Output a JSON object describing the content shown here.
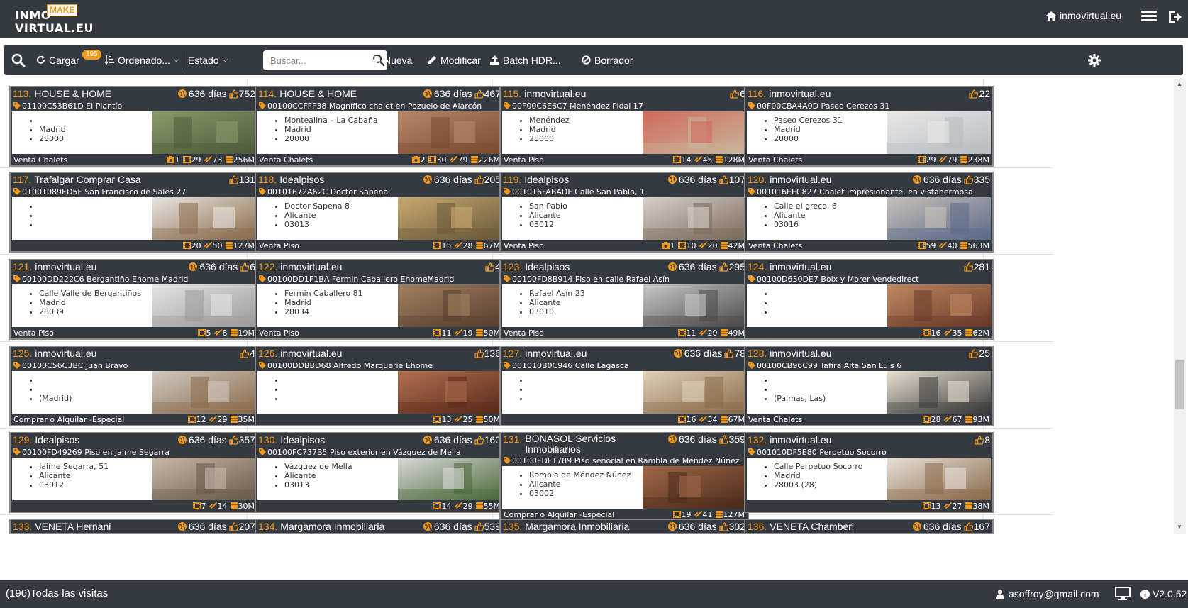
{
  "brand": {
    "line1": "INMO",
    "line2": "VIRTUAL.EU",
    "make": "MAKE"
  },
  "header": {
    "site_link": "inmovirtual.eu"
  },
  "toolbar": {
    "cargar_label": "Cargar",
    "cargar_badge": "195",
    "ordenado_label": "Ordenado...",
    "estado_label": "Estado",
    "search_placeholder": "Buscar...",
    "nueva_label": "Nueva",
    "modificar_label": "Modificar",
    "batch_label": "Batch HDR...",
    "borrador_label": "Borrador"
  },
  "listings": [
    {
      "num": "113.",
      "title": "HOUSE & HOME",
      "days": "636 días",
      "likes": "752",
      "ref": "01100C53B61D El Plantío",
      "lines": [
        "",
        "Madrid",
        "28000"
      ],
      "category": "Venta Chalets",
      "stats": {
        "photos": "1",
        "tours": "29",
        "links": "73",
        "size": "256M"
      }
    },
    {
      "num": "114.",
      "title": "HOUSE & HOME",
      "days": "636 días",
      "likes": "467",
      "ref": "00100CCFFF38 Magnífico chalet en Pozuelo de Alarcón",
      "lines": [
        "Montealina – La Cabaña",
        "Madrid",
        "28000"
      ],
      "category": "Venta Chalets",
      "stats": {
        "photos": "2",
        "tours": "30",
        "links": "79",
        "size": "226M"
      }
    },
    {
      "num": "115.",
      "title": "inmovirtual.eu",
      "days": "",
      "likes": "6",
      "ref": "00F00C6E6C7 Menéndez Pidal 17",
      "lines": [
        "Menéndez",
        "Madrid",
        "28000"
      ],
      "category": "Venta Piso",
      "stats": {
        "photos": "",
        "tours": "14",
        "links": "45",
        "size": "128M"
      }
    },
    {
      "num": "116.",
      "title": "inmovirtual.eu",
      "days": "",
      "likes": "22",
      "ref": "00F00CBA4A0D Paseo Cerezos 31",
      "lines": [
        "Paseo Cerezos 31",
        "Madrid",
        "28000"
      ],
      "category": "Venta Chalets",
      "stats": {
        "photos": "",
        "tours": "29",
        "links": "79",
        "size": "238M"
      }
    },
    {
      "num": "117.",
      "title": "Trafalgar Comprar Casa",
      "days": "",
      "likes": "131",
      "ref": "01001089ED5F San Francisco de Sales 27",
      "lines": [
        "",
        "",
        ""
      ],
      "category": "",
      "stats": {
        "photos": "",
        "tours": "20",
        "links": "50",
        "size": "127M"
      }
    },
    {
      "num": "118.",
      "title": "Idealpisos",
      "days": "636 días",
      "likes": "205",
      "ref": "00101672A62C Doctor Sapena",
      "lines": [
        "Doctor Sapena 8",
        "Alicante",
        "03013"
      ],
      "category": "Venta Piso",
      "stats": {
        "photos": "",
        "tours": "15",
        "links": "28",
        "size": "67M"
      }
    },
    {
      "num": "119.",
      "title": "Idealpisos",
      "days": "636 días",
      "likes": "107",
      "ref": "001016FABADF Calle San Pablo, 1",
      "lines": [
        "San Pablo",
        "Alicante",
        "03012"
      ],
      "category": "Venta Piso",
      "stats": {
        "photos": "1",
        "tours": "10",
        "links": "20",
        "size": "42M"
      }
    },
    {
      "num": "120.",
      "title": "inmovirtual.eu",
      "days": "636 días",
      "likes": "335",
      "ref": "001016EEC827 Chalet impresionante. en vistahermosa",
      "lines": [
        "Calle el greco, 6",
        "Alicante",
        "03016"
      ],
      "category": "Venta Chalets",
      "stats": {
        "photos": "",
        "tours": "59",
        "links": "40",
        "size": "563M"
      }
    },
    {
      "num": "121.",
      "title": "inmovirtual.eu",
      "days": "636 días",
      "likes": "6",
      "ref": "00100DD222C6 Bergantiño Ehome Madrid",
      "lines": [
        "Calle Valle de Bergantiños",
        "Madrid",
        "28039"
      ],
      "category": "Venta Piso",
      "stats": {
        "photos": "",
        "tours": "5",
        "links": "8",
        "size": "19M"
      }
    },
    {
      "num": "122.",
      "title": "inmovirtual.eu",
      "days": "",
      "likes": "4",
      "ref": "00100DD1F1BA Fermin Caballero EhomeMadrid",
      "lines": [
        "Fermin Caballero 81",
        "Madrid",
        "28034"
      ],
      "category": "Venta Piso",
      "stats": {
        "photos": "",
        "tours": "11",
        "links": "19",
        "size": "50M"
      }
    },
    {
      "num": "123.",
      "title": "Idealpisos",
      "days": "636 días",
      "likes": "295",
      "ref": "00100FD8B914 Piso en calle Rafael Asín",
      "lines": [
        "Rafael Asín 23",
        "Alicante",
        "03010"
      ],
      "category": "Venta Piso",
      "stats": {
        "photos": "",
        "tours": "11",
        "links": "20",
        "size": "49M"
      }
    },
    {
      "num": "124.",
      "title": "inmovirtual.eu",
      "days": "",
      "likes": "281",
      "ref": "00100D630DE7 Boix y Morer Vendedirect",
      "lines": [
        "",
        "",
        ""
      ],
      "category": "",
      "stats": {
        "photos": "",
        "tours": "16",
        "links": "35",
        "size": "62M"
      }
    },
    {
      "num": "125.",
      "title": "inmovirtual.eu",
      "days": "",
      "likes": "4",
      "ref": "00100C56C3BC Juan Bravo",
      "lines": [
        "",
        "",
        "(Madrid)"
      ],
      "category": "Comprar o Alquilar -Especial",
      "stats": {
        "photos": "",
        "tours": "12",
        "links": "29",
        "size": "35M"
      }
    },
    {
      "num": "126.",
      "title": "inmovirtual.eu",
      "days": "",
      "likes": "136",
      "ref": "00100DDBBD68 Alfredo Marquerie Ehome",
      "lines": [
        "",
        "",
        ""
      ],
      "category": "",
      "stats": {
        "photos": "",
        "tours": "13",
        "links": "25",
        "size": "50M"
      }
    },
    {
      "num": "127.",
      "title": "inmovirtual.eu",
      "days": "636 días",
      "likes": "78",
      "ref": "001010B0C946 Calle Lagasca",
      "lines": [
        "",
        "",
        ""
      ],
      "category": "",
      "stats": {
        "photos": "",
        "tours": "16",
        "links": "34",
        "size": "67M"
      }
    },
    {
      "num": "128.",
      "title": "inmovirtual.eu",
      "days": "",
      "likes": "25",
      "ref": "00100CB96C99 Tafira Alta San Luis 6",
      "lines": [
        "",
        "",
        "(Palmas, Las)"
      ],
      "category": "Venta Chalets",
      "stats": {
        "photos": "",
        "tours": "28",
        "links": "67",
        "size": "93M"
      }
    },
    {
      "num": "129.",
      "title": "Idealpisos",
      "days": "636 días",
      "likes": "357",
      "ref": "00100FD49269 Piso en Jaime Segarra",
      "lines": [
        "Jaime Segarra, 51",
        "Alicante",
        "03012"
      ],
      "category": "",
      "stats": {
        "photos": "",
        "tours": "7",
        "links": "14",
        "size": "30M"
      }
    },
    {
      "num": "130.",
      "title": "Idealpisos",
      "days": "636 días",
      "likes": "160",
      "ref": "00100FC737B5 Piso exterior en Vázquez de Mella",
      "lines": [
        "Vázquez de Mella",
        "Alicante",
        "03013"
      ],
      "category": "",
      "stats": {
        "photos": "",
        "tours": "14",
        "links": "29",
        "size": "55M"
      }
    },
    {
      "num": "131.",
      "title": "BONASOL Servicios Inmobiliarios",
      "days": "636 días",
      "likes": "359",
      "ref": "00100FDF1789 Piso señorial en Rambla de Méndez Núñez",
      "lines": [
        "Rambla de Méndez Núñez",
        "Alicante",
        "03002"
      ],
      "category": "Comprar o Alquilar -Especial",
      "stats": {
        "photos": "",
        "tours": "19",
        "links": "41",
        "size": "127M"
      }
    },
    {
      "num": "132.",
      "title": "inmovirtual.eu",
      "days": "",
      "likes": "8",
      "ref": "001010DF5E80 Perpetuo Socorro",
      "lines": [
        "Calle Perpetuo Socorro",
        "Madrid",
        "28003 (28)"
      ],
      "category": "",
      "stats": {
        "photos": "",
        "tours": "13",
        "links": "27",
        "size": "38M"
      }
    },
    {
      "num": "133.",
      "title": "VENETA Hernani",
      "days": "636 días",
      "likes": "207",
      "ref": "",
      "lines": [
        "",
        "",
        ""
      ],
      "category": "",
      "stats": {
        "photos": "",
        "tours": "",
        "links": "",
        "size": ""
      }
    },
    {
      "num": "134.",
      "title": "Margamora Inmobiliaria",
      "days": "636 días",
      "likes": "539",
      "ref": "",
      "lines": [
        "",
        "",
        ""
      ],
      "category": "",
      "stats": {
        "photos": "",
        "tours": "",
        "links": "",
        "size": ""
      }
    },
    {
      "num": "135.",
      "title": "Margamora Inmobiliaria",
      "days": "636 días",
      "likes": "302",
      "ref": "",
      "lines": [
        "",
        "",
        ""
      ],
      "category": "",
      "stats": {
        "photos": "",
        "tours": "",
        "links": "",
        "size": ""
      }
    },
    {
      "num": "136.",
      "title": "VENETA Chamberi",
      "days": "636 días",
      "likes": "167",
      "ref": "",
      "lines": [
        "",
        "",
        ""
      ],
      "category": "",
      "stats": {
        "photos": "",
        "tours": "",
        "links": "",
        "size": ""
      }
    }
  ],
  "thumb_colors": [
    [
      "#4d5b3a",
      "#8a9a6a"
    ],
    [
      "#7a4a32",
      "#b8866a"
    ],
    [
      "#c8b49a",
      "#d06a5a"
    ],
    [
      "#b8bcc0",
      "#e8e8e8"
    ],
    [
      "#8a6a4a",
      "#e8e4e0"
    ],
    [
      "#6a5a3a",
      "#c8a870"
    ],
    [
      "#7a6a5a",
      "#d8d0c8"
    ],
    [
      "#5a6a8a",
      "#c8c0b8"
    ],
    [
      "#9a9a9a",
      "#e4e4e4"
    ],
    [
      "#5a4030",
      "#a08060"
    ],
    [
      "#4a4a4a",
      "#c8c8c8"
    ],
    [
      "#6a3a2a",
      "#c08860"
    ],
    [
      "#8a6a4a",
      "#d0c8c0"
    ],
    [
      "#5a2a1a",
      "#b07050"
    ],
    [
      "#8a6a4a",
      "#e0d0b8"
    ],
    [
      "#3a3a3a",
      "#e8e0d0"
    ],
    [
      "#6a5a4a",
      "#c8b8a8"
    ],
    [
      "#4a6a3a",
      "#d8d8d8"
    ],
    [
      "#4a2a1a",
      "#a06848"
    ],
    [
      "#8a6a4a",
      "#e8e0d8"
    ]
  ],
  "footer": {
    "visits": "(196)Todas las visitas",
    "user": "asoffroy@gmail.com",
    "version": "V2.0.52"
  },
  "colors": {
    "dark": "#353a40",
    "accent": "#f29a1e",
    "border": "#8a8a8a"
  }
}
